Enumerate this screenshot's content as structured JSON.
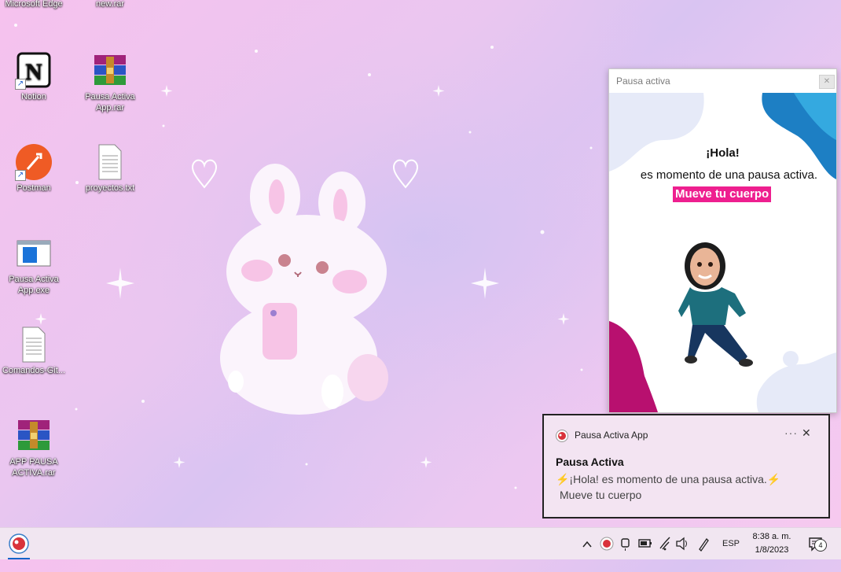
{
  "desktop": {
    "icons": [
      {
        "label": "Microsoft Edge",
        "icon": "edge-icon"
      },
      {
        "label": "new.rar",
        "icon": "winrar-icon"
      },
      {
        "label": "Notion",
        "icon": "notion-icon"
      },
      {
        "label": "Pausa Activa App.rar",
        "icon": "winrar-icon"
      },
      {
        "label": "Postman",
        "icon": "postman-icon"
      },
      {
        "label": "proyectos.txt",
        "icon": "text-file-icon"
      },
      {
        "label": "Pausa Activa App.exe",
        "icon": "app-window-icon"
      },
      {
        "label": "Comandos-Git...",
        "icon": "text-file-icon"
      },
      {
        "label": "APP PAUSA ACTIVA.rar",
        "icon": "winrar-icon"
      }
    ]
  },
  "popup": {
    "title": "Pausa activa",
    "close_label": "✕",
    "greeting": "¡Hola!",
    "message": "es momento de una pausa activa.",
    "highlight": "Mueve tu cuerpo",
    "colors": {
      "accent": "#ee1f8f",
      "blue": "#1d7fc4",
      "magenta": "#b8106f"
    }
  },
  "toast": {
    "app_name": "Pausa Activa App",
    "more_label": "···",
    "close_label": "✕",
    "title": "Pausa Activa",
    "line1": "⚡¡Hola! es momento de una pausa activa.⚡",
    "line2": "Mueve tu cuerpo"
  },
  "taskbar": {
    "tray": {
      "language": "ESP",
      "time": "8:38 a. m.",
      "date": "1/8/2023",
      "notification_count": "4"
    }
  }
}
